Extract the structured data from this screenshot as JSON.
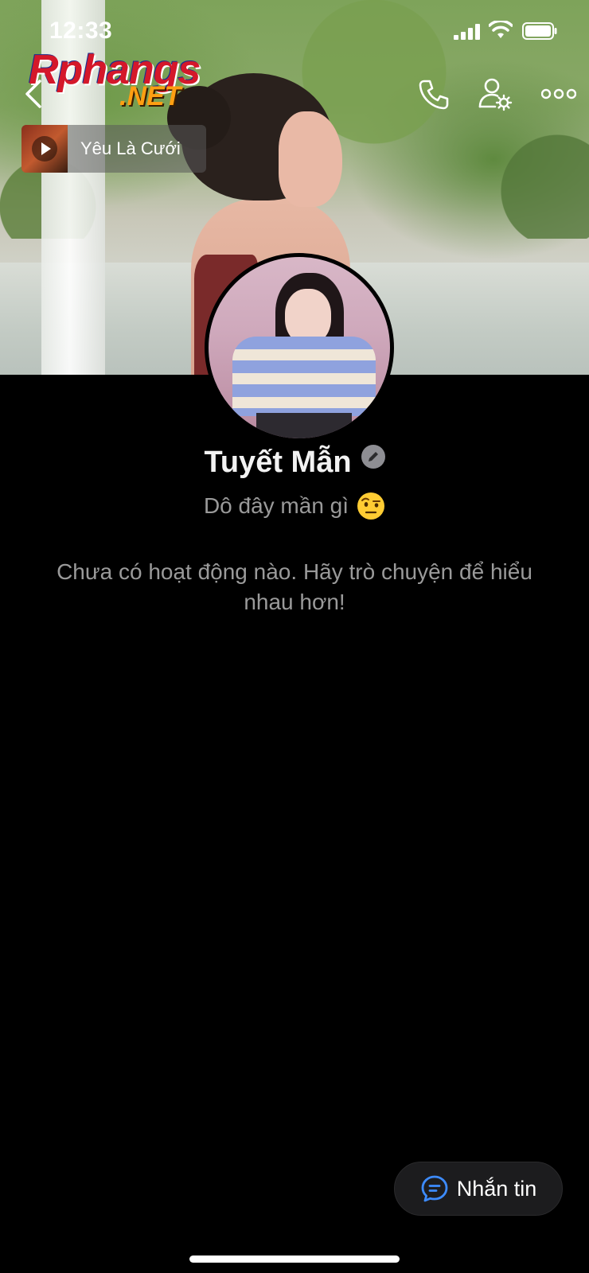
{
  "status_bar": {
    "time": "12:33"
  },
  "watermark": {
    "main": "Rphangs",
    "sub": ".NET"
  },
  "nav": {
    "icons": [
      "back-icon",
      "phone-icon",
      "user-settings-icon",
      "more-icon"
    ]
  },
  "music": {
    "title": "Yêu Là Cưới"
  },
  "profile": {
    "name": "Tuyết Mẫn",
    "bio": "Dô đây mần gì",
    "bio_emoji": "face-with-raised-eyebrow"
  },
  "feed": {
    "empty_message": "Chưa có hoạt động nào. Hãy trò chuyện để hiểu nhau hơn!"
  },
  "actions": {
    "message_label": "Nhắn tin"
  },
  "colors": {
    "background": "#000000",
    "accent": "#3d8bfd",
    "secondary_text": "#9a9a9a",
    "floating_button": "#1c1c1e"
  }
}
